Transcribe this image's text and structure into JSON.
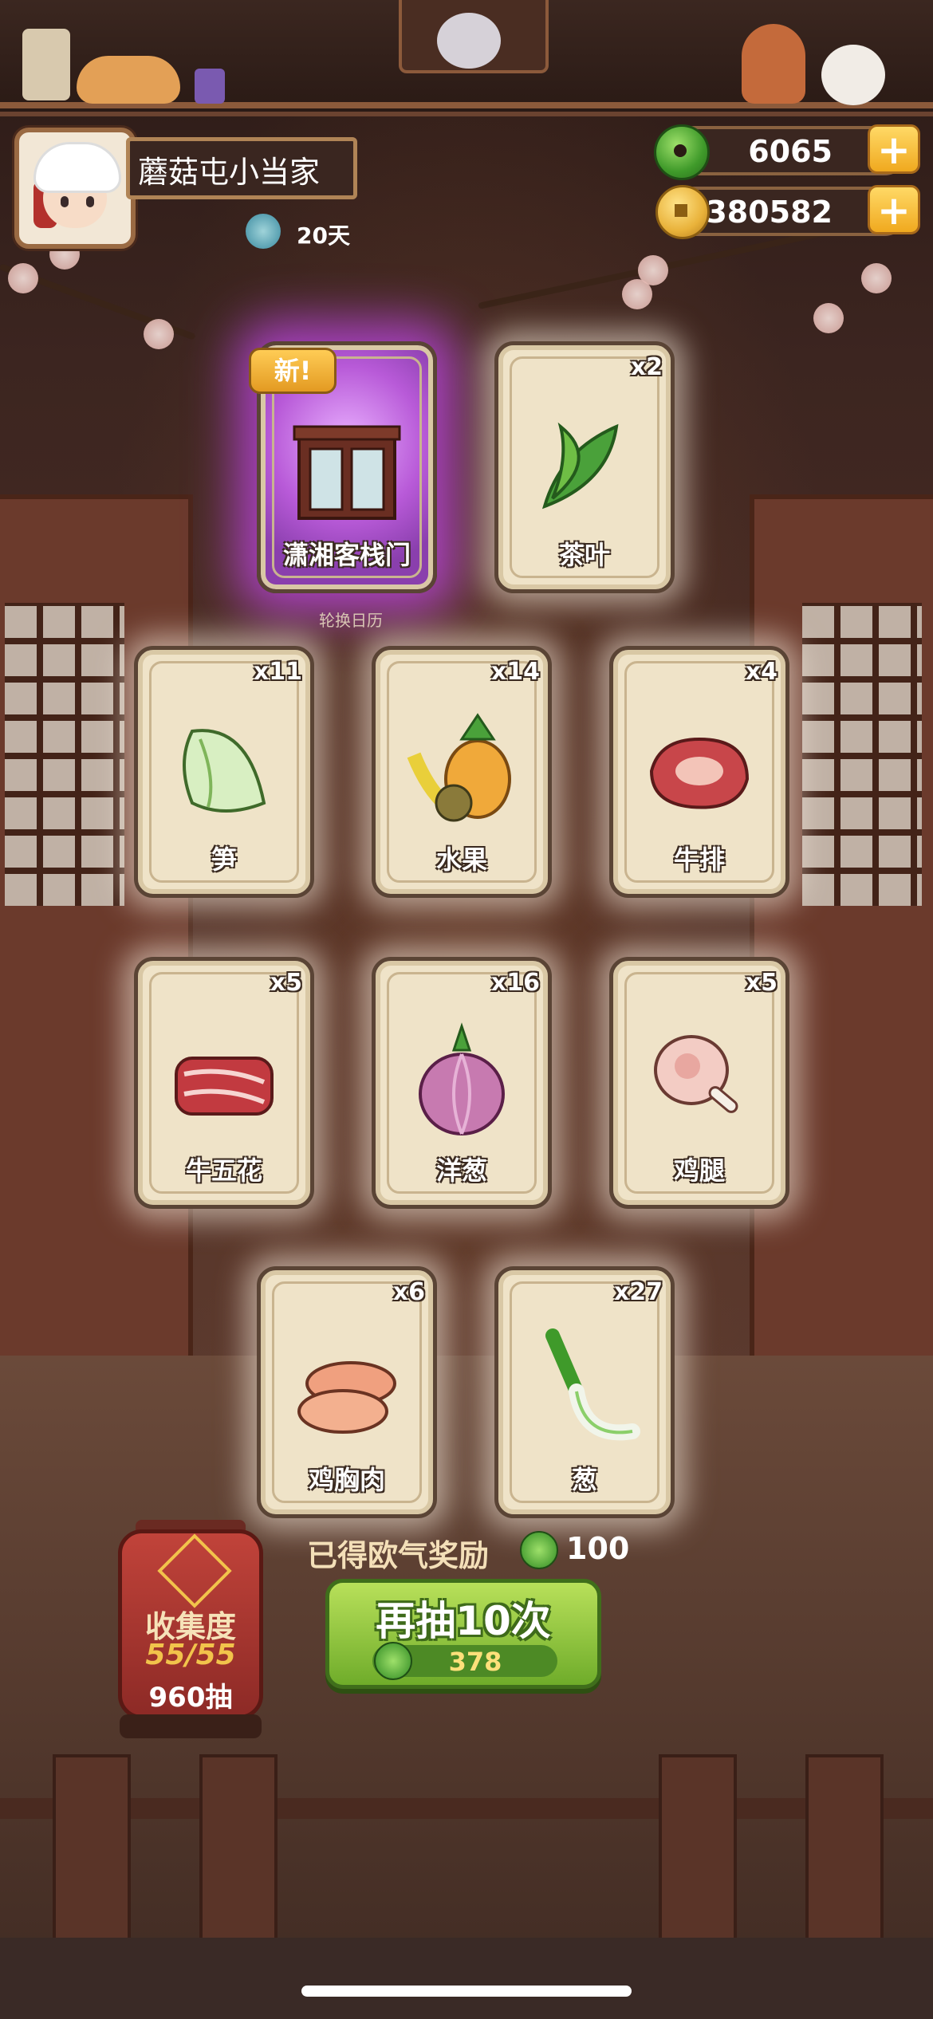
{
  "player": {
    "name": "蘑菇屯小当家",
    "days": "20天"
  },
  "currencies": {
    "jade": "6065",
    "coins": "53380582"
  },
  "new_tag": "新!",
  "sub_label": "轮换日历",
  "cards": [
    {
      "name": "潇湘客栈门",
      "count": "",
      "is_new": true,
      "icon": "door-icon"
    },
    {
      "name": "茶叶",
      "count": "x2",
      "is_new": false,
      "icon": "tea-leaf-icon"
    },
    {
      "name": "笋",
      "count": "x11",
      "is_new": false,
      "icon": "bamboo-shoot-icon"
    },
    {
      "name": "水果",
      "count": "x14",
      "is_new": false,
      "icon": "fruit-icon"
    },
    {
      "name": "牛排",
      "count": "x4",
      "is_new": false,
      "icon": "steak-icon"
    },
    {
      "name": "牛五花",
      "count": "x5",
      "is_new": false,
      "icon": "beef-belly-icon"
    },
    {
      "name": "洋葱",
      "count": "x16",
      "is_new": false,
      "icon": "onion-icon"
    },
    {
      "name": "鸡腿",
      "count": "x5",
      "is_new": false,
      "icon": "drumstick-icon"
    },
    {
      "name": "鸡胸肉",
      "count": "x6",
      "is_new": false,
      "icon": "chicken-breast-icon"
    },
    {
      "name": "葱",
      "count": "x27",
      "is_new": false,
      "icon": "scallion-icon"
    }
  ],
  "reward": {
    "label": "已得欧气奖励",
    "value": "100"
  },
  "draw_button": {
    "label": "再抽10次",
    "cost": "378"
  },
  "collection": {
    "title": "收集度",
    "progress": "55/55",
    "draws": "960抽",
    "progress_fraction": 1.0
  },
  "colors": {
    "accent_green": "#6fac2a",
    "gold": "#f0a91f",
    "card_bg": "#efe3c8",
    "new_glow": "#b85ad8"
  }
}
